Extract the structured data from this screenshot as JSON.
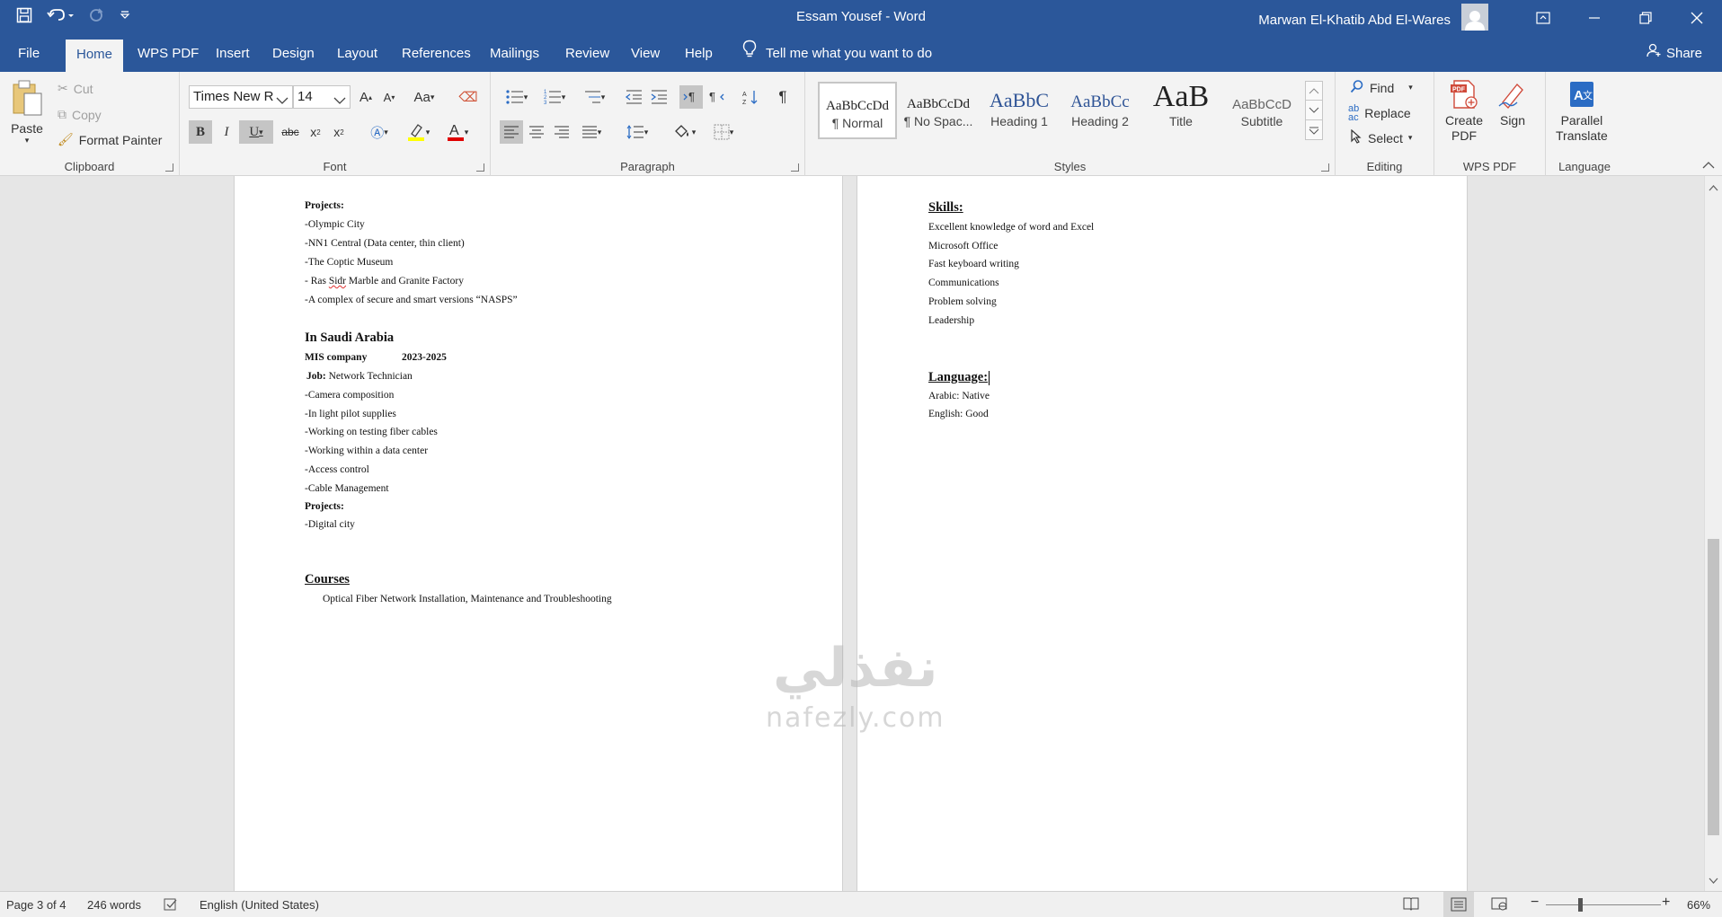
{
  "window": {
    "title": "Essam Yousef  -  Word",
    "user": "Marwan El-Khatib Abd El-Wares"
  },
  "tabs": [
    "File",
    "Home",
    "WPS PDF",
    "Insert",
    "Design",
    "Layout",
    "References",
    "Mailings",
    "Review",
    "View",
    "Help"
  ],
  "active_tab": "Home",
  "tellme": "Tell me what you want to do",
  "share": "Share",
  "ribbon": {
    "clipboard": {
      "label": "Clipboard",
      "paste": "Paste",
      "cut": "Cut",
      "copy": "Copy",
      "format_painter": "Format Painter"
    },
    "font": {
      "label": "Font",
      "font_name": "Times New R",
      "font_size": "14",
      "change_case": "Aa"
    },
    "paragraph": {
      "label": "Paragraph"
    },
    "styles": {
      "label": "Styles",
      "items": [
        {
          "sample": "AaBbCcDd",
          "name": "¶ Normal"
        },
        {
          "sample": "AaBbCcDd",
          "name": "¶ No Spac..."
        },
        {
          "sample": "AaBbC",
          "name": "Heading 1"
        },
        {
          "sample": "AaBbCc",
          "name": "Heading 2"
        },
        {
          "sample": "AaB",
          "name": "Title"
        },
        {
          "sample": "AaBbCcD",
          "name": "Subtitle"
        }
      ]
    },
    "editing": {
      "label": "Editing",
      "find": "Find",
      "replace": "Replace",
      "select": "Select"
    },
    "wps_pdf": {
      "label": "WPS PDF",
      "create_pdf_1": "Create",
      "create_pdf_2": "PDF",
      "sign": "Sign"
    },
    "language": {
      "label": "Language",
      "parallel_1": "Parallel",
      "parallel_2": "Translate"
    }
  },
  "page1": {
    "projects_title": "Projects:",
    "projects": [
      "-Olympic City",
      "-NN1 Central (Data center, thin client)",
      "-The Coptic Museum"
    ],
    "ras_prefix": "- Ras ",
    "ras_word": "Sidr",
    "ras_suffix": " Marble and Granite Factory",
    "project_last": "-A complex of secure and smart versions “NASPS”",
    "saudi_heading": "In Saudi Arabia",
    "company": "MIS company",
    "company_years": "2023-2025",
    "job_label": "Job:",
    "job_value": " Network Technician",
    "tasks": [
      "-Camera composition",
      "-In light pilot supplies",
      "-Working on testing fiber cables",
      "-Working within a data center",
      "-Access control",
      "-Cable Management"
    ],
    "projects2_title": "Projects:",
    "projects2": [
      "-Digital city"
    ],
    "courses_heading": "Courses",
    "course": "Optical Fiber Network Installation, Maintenance and Troubleshooting"
  },
  "page2": {
    "skills_heading": "Skills:",
    "skills": [
      "Excellent knowledge of word and Excel",
      "Microsoft Office",
      "Fast keyboard writing",
      "Communications",
      "Problem solving",
      "Leadership"
    ],
    "language_heading": "Language:",
    "languages": [
      "Arabic: Native",
      "English: Good"
    ]
  },
  "watermark": {
    "arabic": "نفذلي",
    "latin": "nafezly.com"
  },
  "status": {
    "page": "Page 3 of 4",
    "words": "246 words",
    "language": "English (United States)",
    "zoom": "66%",
    "zoom_minus": "−",
    "zoom_plus": "+"
  }
}
